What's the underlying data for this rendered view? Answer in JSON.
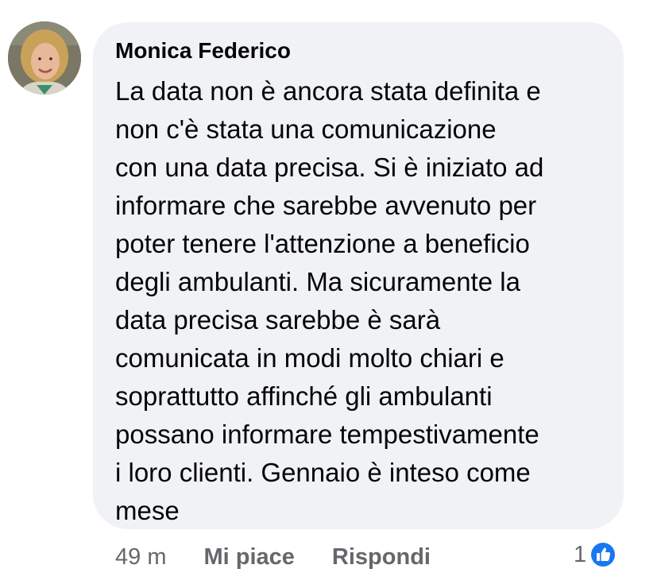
{
  "comment": {
    "author": "Monica Federico",
    "text": "La data non è ancora stata definita e\nnon c'è  stata una comunicazione\ncon una data precisa. Si è iniziato ad\ninformare che sarebbe avvenuto per\npoter tenere l'attenzione a beneficio\ndegli ambulanti. Ma sicuramente la\ndata precisa sarebbe è sarà\ncomunicata in modi molto chiari e\nsoprattutto affinché gli ambulanti\npossano informare tempestivamente\ni loro clienti. Gennaio è inteso come\nmese"
  },
  "actions": {
    "time": "49 m",
    "like_label": "Mi piace",
    "reply_label": "Rispondi"
  },
  "reactions": {
    "count": "1",
    "icon": "thumbs-up-icon",
    "color": "#1877f2"
  },
  "colors": {
    "bubble": "#f0f2f5",
    "text": "#050505",
    "secondary": "#65676b"
  }
}
